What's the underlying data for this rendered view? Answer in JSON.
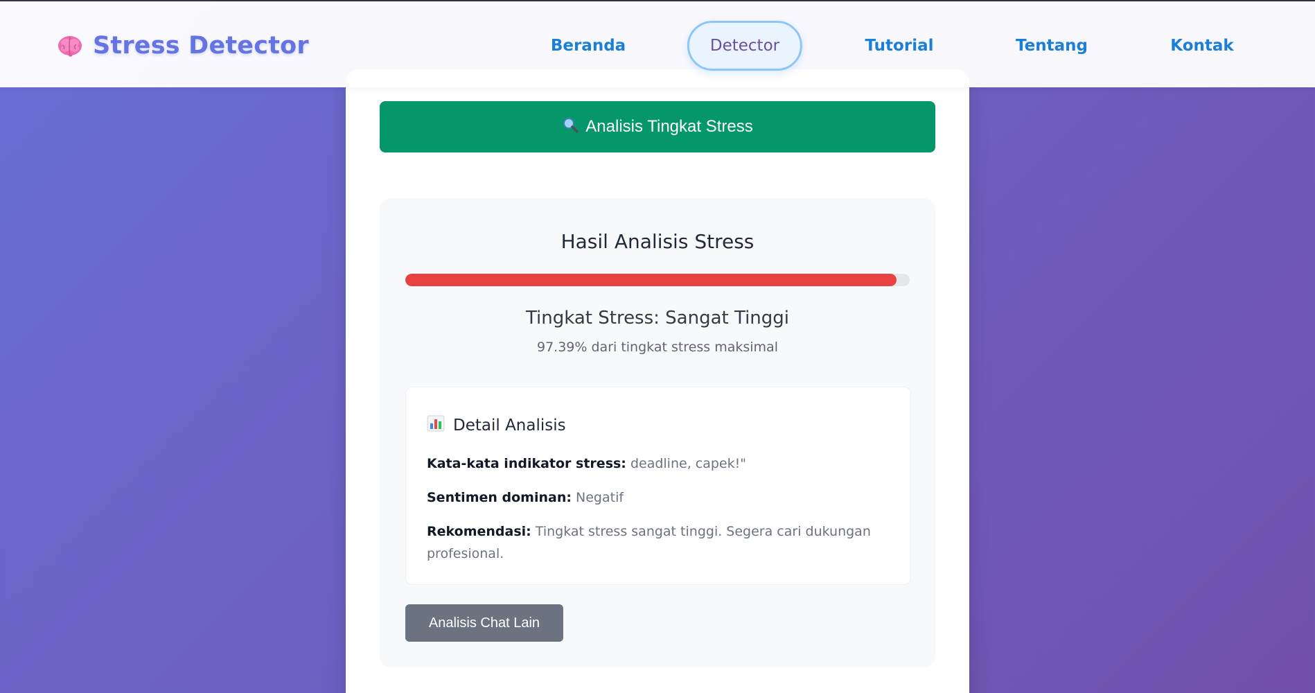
{
  "header": {
    "logo_text": "Stress Detector",
    "logo_icon": "brain-icon",
    "nav": [
      {
        "label": "Beranda",
        "active": false
      },
      {
        "label": "Detector",
        "active": true
      },
      {
        "label": "Tutorial",
        "active": false
      },
      {
        "label": "Tentang",
        "active": false
      },
      {
        "label": "Kontak",
        "active": false
      }
    ]
  },
  "analyze_button": {
    "icon": "magnifier-icon",
    "label": "Analisis Tingkat Stress"
  },
  "result": {
    "title": "Hasil Analisis Stress",
    "progress_fraction": 0.9739,
    "progress_color": "#e84141",
    "level_text": "Tingkat Stress: Sangat Tinggi",
    "percent_text": "97.39% dari tingkat stress maksimal",
    "detail": {
      "icon": "bar-chart-icon",
      "title": "Detail Analisis",
      "keywords_label": "Kata-kata indikator stress:",
      "keywords_value": "deadline, capek!\"",
      "sentiment_label": "Sentimen dominan:",
      "sentiment_value": "Negatif",
      "recommendation_label": "Rekomendasi:",
      "recommendation_value": "Tingkat stress sangat tinggi. Segera cari dukungan profesional."
    },
    "other_button_label": "Analisis Chat Lain"
  },
  "colors": {
    "brand": "#6674e2",
    "nav_link": "#1b7fd8",
    "primary_button": "#05976a",
    "secondary_button": "#6b7280"
  }
}
